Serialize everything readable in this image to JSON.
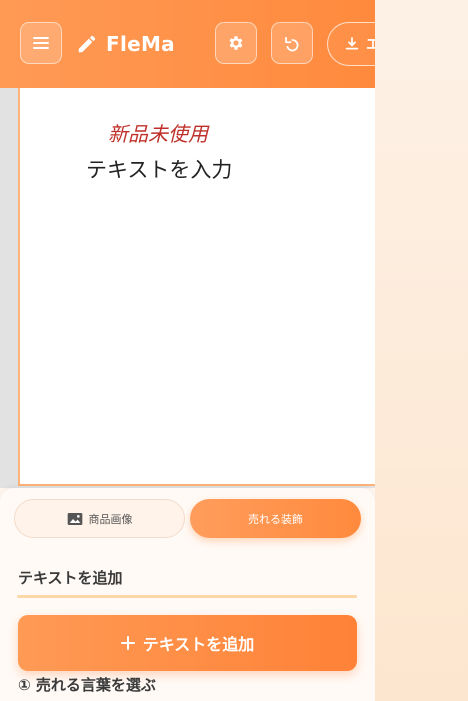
{
  "header": {
    "brand_title": "FleMa",
    "export_label": "エクスポート",
    "icons": [
      "menu-icon",
      "pencil-icon",
      "gear-icon",
      "undo-icon",
      "download-icon"
    ]
  },
  "canvas": {
    "tag_text": "新品未使用",
    "body_text": "テキストを入力"
  },
  "panel": {
    "tabs": [
      {
        "label": "商品画像",
        "icon": "image-icon",
        "active": false
      },
      {
        "label": "売れる装飾",
        "active": true
      }
    ],
    "section_title": "テキストを追加",
    "add_button_label": "テキストを追加",
    "step_title": "① 売れる言葉を選ぶ"
  },
  "colors": {
    "accent": "#ff8a3d",
    "tag_red": "#c0302a",
    "section_underline": "#fcd7a8"
  }
}
